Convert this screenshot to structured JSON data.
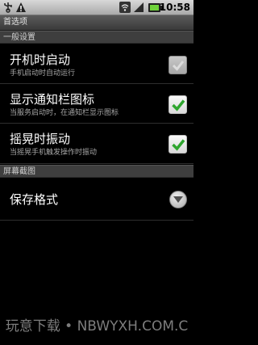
{
  "status_bar": {
    "time": "10:58",
    "icons": [
      "usb-icon",
      "warning-icon",
      "wifi-icon",
      "signal-icon",
      "battery-icon"
    ]
  },
  "title_bar": {
    "title": "首选项"
  },
  "sections": [
    {
      "header": "一般设置",
      "items": [
        {
          "title": "开机时启动",
          "summary": "手机启动时自动运行",
          "widget": "checkbox",
          "checked": true,
          "enabled": false
        },
        {
          "title": "显示通知栏图标",
          "summary": "当服务启动时，在通知栏显示图标",
          "widget": "checkbox",
          "checked": true,
          "enabled": true
        },
        {
          "title": "摇晃时振动",
          "summary": "当摇晃手机触发操作时振动",
          "widget": "checkbox",
          "checked": true,
          "enabled": true
        }
      ]
    },
    {
      "header": "屏幕截图",
      "items": [
        {
          "title": "保存格式",
          "widget": "dropdown"
        }
      ]
    }
  ],
  "watermark": "玩意下载 • NBWYXH.COM.C",
  "colors": {
    "check_green": "#2fa62f",
    "background": "#000000",
    "category_bg": "#3e3e3e"
  }
}
